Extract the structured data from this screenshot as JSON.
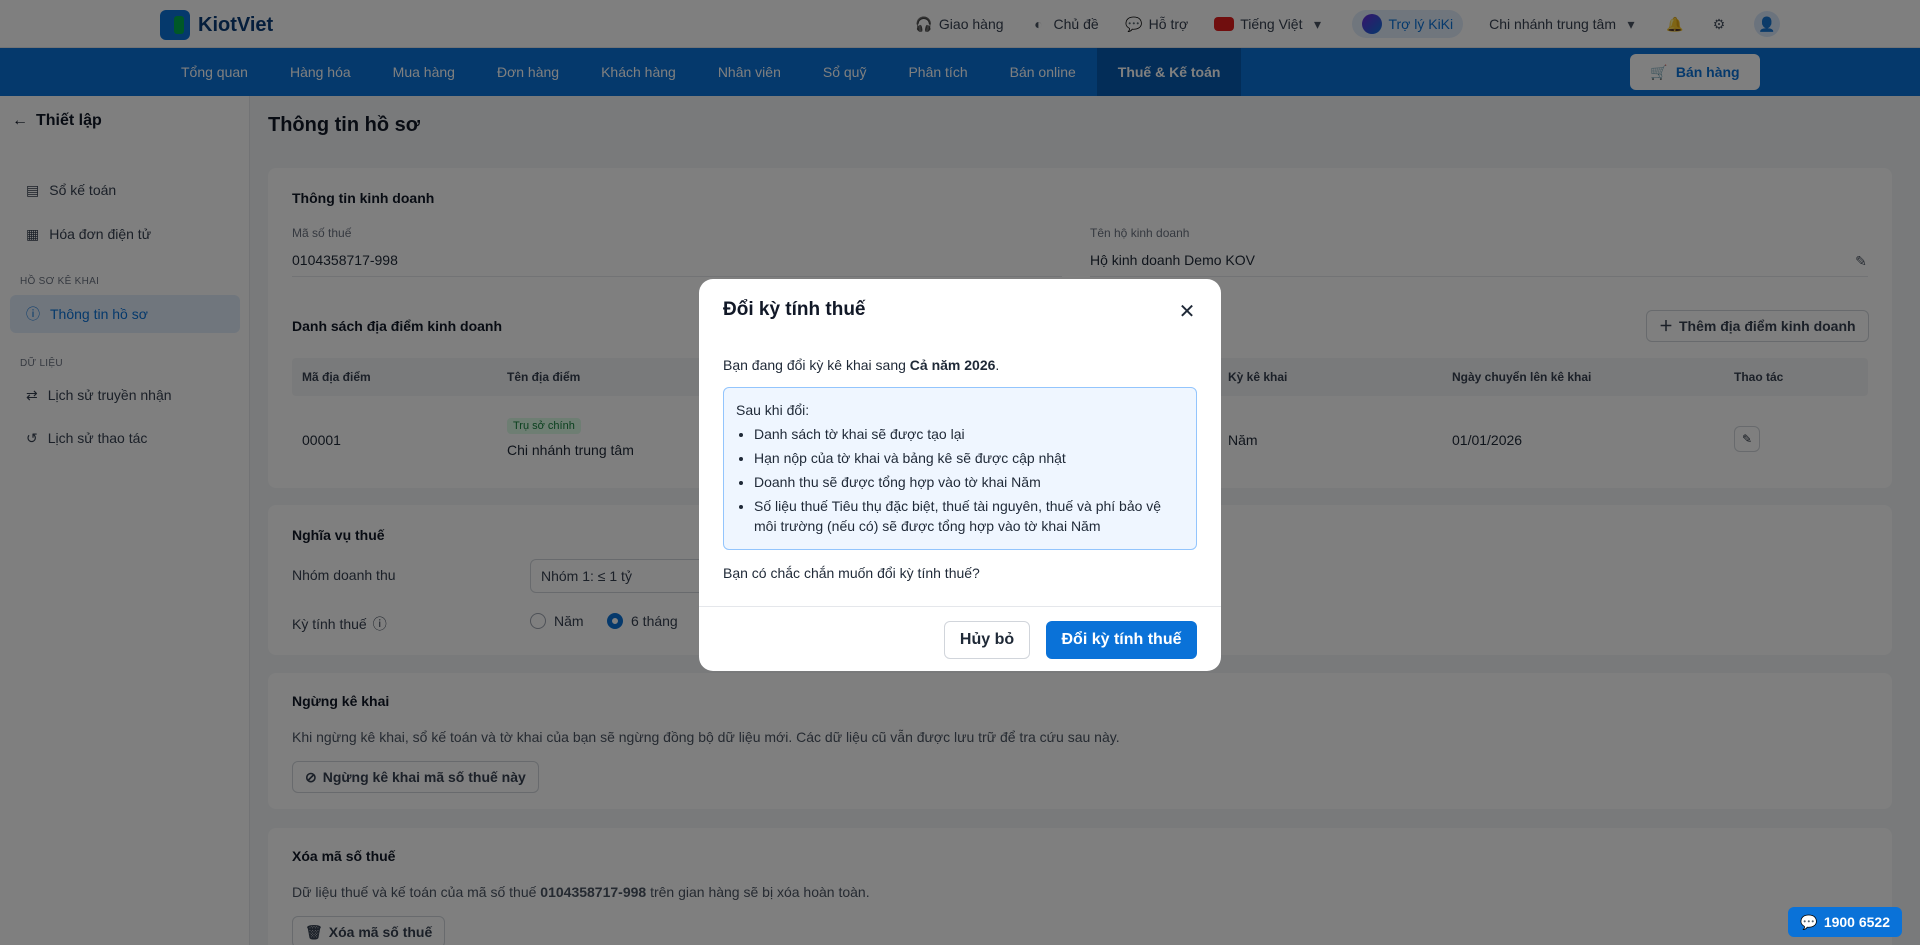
{
  "app": {
    "logo_text": "KiotViet"
  },
  "topbar": {
    "delivery": "Giao hàng",
    "theme": "Chủ đề",
    "support": "Hỗ trợ",
    "language": "Tiếng Việt",
    "assistant": "Trợ lý KiKi",
    "branch": "Chi nhánh trung tâm"
  },
  "nav": {
    "items": [
      "Tổng quan",
      "Hàng hóa",
      "Mua hàng",
      "Đơn hàng",
      "Khách hàng",
      "Nhân viên",
      "Sổ quỹ",
      "Phân tích",
      "Bán online",
      "Thuế & Kế toán"
    ],
    "sell_label": "Bán hàng"
  },
  "sidebar": {
    "back_label": "Thiết lập",
    "item_ledger": "Sổ kế toán",
    "item_einvoice": "Hóa đơn điện tử",
    "group_profile": "HỒ SƠ KÊ KHAI",
    "item_profile": "Thông tin hồ sơ",
    "group_data": "DỮ LIỆU",
    "item_transmit": "Lịch sử truyền nhận",
    "item_actions": "Lịch sử thao tác"
  },
  "main": {
    "page_title": "Thông tin hồ sơ",
    "business": {
      "title": "Thông tin kinh doanh",
      "tax_code_label": "Mã số thuế",
      "tax_code_value": "0104358717-998",
      "name_label": "Tên hộ kinh doanh",
      "name_value": "Hộ kinh doanh Demo KOV",
      "locations_title": "Danh sách địa điểm kinh doanh",
      "add_location": "Thêm địa điểm kinh doanh",
      "table_headers": {
        "code": "Mã địa điểm",
        "name": "Tên địa điểm",
        "period": "Kỳ kê khai",
        "date": "Ngày chuyển lên kê khai",
        "action": "Thao tác"
      },
      "row": {
        "code": "00001",
        "tag": "Trụ sở chính",
        "name": "Chi nhánh trung tâm",
        "period": "Năm",
        "date": "01/01/2026"
      }
    },
    "obligation": {
      "title": "Nghĩa vụ thuế",
      "group_label": "Nhóm doanh thu",
      "group_value": "Nhóm 1: ≤ 1 tỷ",
      "period_label": "Kỳ tính thuế",
      "opt_year": "Năm",
      "opt_6m": "6 tháng"
    },
    "stop": {
      "title": "Ngừng kê khai",
      "desc": "Khi ngừng kê khai, sổ kế toán và tờ khai của bạn sẽ ngừng đồng bộ dữ liệu mới. Các dữ liệu cũ vẫn được lưu trữ để tra cứu sau này.",
      "button": "Ngừng kê khai mã số thuế này"
    },
    "delete": {
      "title": "Xóa mã số thuế",
      "desc_pre": "Dữ liệu thuế và kế toán của mã số thuế ",
      "desc_code": "0104358717-998",
      "desc_post": " trên gian hàng sẽ bị xóa hoàn toàn.",
      "button": "Xóa mã số thuế"
    }
  },
  "modal": {
    "title": "Đổi kỳ tính thuế",
    "intro_pre": "Bạn đang đổi kỳ kê khai sang ",
    "intro_bold": "Cả năm 2026",
    "intro_post": ".",
    "after_label": "Sau khi đổi:",
    "bullets": [
      "Danh sách tờ khai sẽ được tạo lại",
      "Hạn nộp của tờ khai và bảng kê sẽ được cập nhật",
      "Doanh thu sẽ được tổng hợp vào tờ khai Năm",
      "Số liệu thuế Tiêu thụ đặc biệt, thuế tài nguyên, thuế và phí bảo vệ môi trường (nếu có) sẽ được tổng hợp vào tờ khai Năm"
    ],
    "question": "Bạn có chắc chắn muốn đổi kỳ tính thuế?",
    "cancel": "Hủy bỏ",
    "confirm": "Đổi kỳ tính thuế"
  },
  "hotline": "1900 6522",
  "colors": {
    "brand": "#0a72d8",
    "nav_active": "#075bb0",
    "success": "#15803d"
  }
}
